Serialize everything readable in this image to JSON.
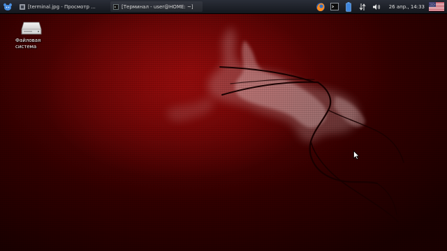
{
  "panel": {
    "menu_icon": "xfce-mouse-icon",
    "tasks": [
      {
        "icon": "image-viewer-icon",
        "label": "[terminal.jpg - Просмотр ..."
      },
      {
        "icon": "terminal-icon",
        "label": "[Терминал - user@HOME: ~]"
      }
    ],
    "tray": {
      "browser_icon": "firefox-icon",
      "terminal_icon": "terminal-icon",
      "battery_icon": "battery-icon",
      "network_icon": "network-transfer-icon",
      "volume_icon": "speaker-icon",
      "clock": "26 апр., 14:33",
      "layout_flag": "us-flag-icon"
    }
  },
  "desktop": {
    "icons": [
      {
        "icon": "hard-drive-icon",
        "label_line1": "Файловая",
        "label_line2": "система"
      }
    ]
  },
  "colors": {
    "background": "#5a0303",
    "panel": "#1e2128",
    "accent": "#ff9a3c"
  }
}
